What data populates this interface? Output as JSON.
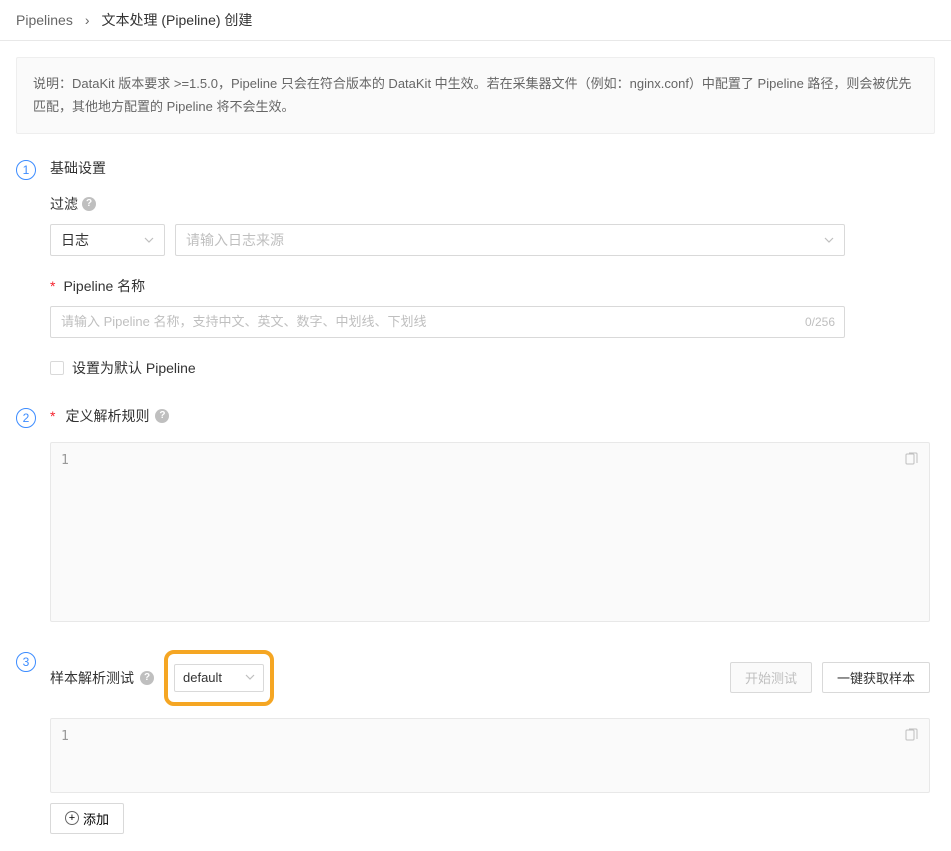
{
  "breadcrumb": {
    "root": "Pipelines",
    "current": "文本处理 (Pipeline) 创建"
  },
  "banner": {
    "text": "说明：DataKit 版本要求 >=1.5.0，Pipeline 只会在符合版本的 DataKit 中生效。若在采集器文件（例如：nginx.conf）中配置了 Pipeline 路径，则会被优先匹配，其他地方配置的 Pipeline 将不会生效。"
  },
  "step1": {
    "number": "1",
    "title": "基础设置",
    "filter_label": "过滤",
    "type_select_value": "日志",
    "source_placeholder": "请输入日志来源",
    "name_label": "Pipeline 名称",
    "name_placeholder": "请输入 Pipeline 名称，支持中文、英文、数字、中划线、下划线",
    "name_counter": "0/256",
    "default_checkbox_label": "设置为默认 Pipeline"
  },
  "step2": {
    "number": "2",
    "title": "定义解析规则",
    "editor_line": "1"
  },
  "step3": {
    "number": "3",
    "title": "样本解析测试",
    "default_select_value": "default",
    "test_button": "开始测试",
    "fetch_button": "一键获取样本",
    "editor_line": "1",
    "add_button": "添加"
  }
}
